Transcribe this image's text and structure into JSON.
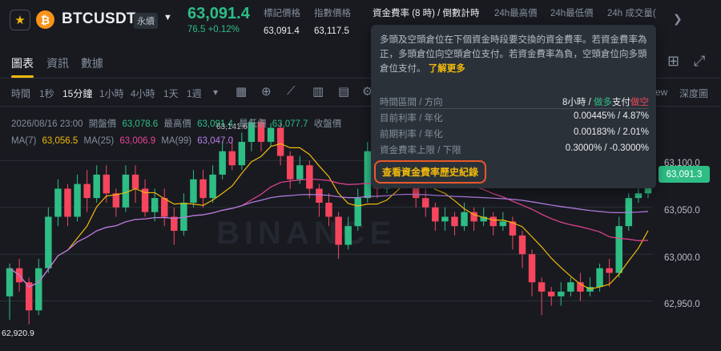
{
  "header": {
    "symbol": "BTCUSDT",
    "contract_type": "永續",
    "coin_glyph": "₿",
    "last_price": "63,091.4",
    "change": "76.5 +0.12%",
    "stats": [
      {
        "label": "標記價格",
        "value": "63,091.4"
      },
      {
        "label": "指數價格",
        "value": "63,117.5"
      },
      {
        "label": "資金費率 (8 時) / 倒數計時",
        "value": ""
      },
      {
        "label": "24h最高價",
        "value": ""
      },
      {
        "label": "24h最低價",
        "value": ""
      },
      {
        "label": "24h 成交量(",
        "value": ""
      }
    ]
  },
  "tabs": [
    "圖表",
    "資訊",
    "數據"
  ],
  "timeframes": [
    "時間",
    "1秒",
    "15分鐘",
    "1小時",
    "4小時",
    "1天",
    "1週"
  ],
  "active_timeframe": "15分鐘",
  "view_tabs": [
    "ew",
    "深度圖"
  ],
  "legend": {
    "date": "2026/08/16 23:00",
    "open_label": "開盤價",
    "open": "63,078.6",
    "high_label": "最高價",
    "high": "63,091.4",
    "low_label": "最低價",
    "low": "63,077.7",
    "close_label": "收盤價",
    "ma7_label": "MA(7)",
    "ma7": "63,056.5",
    "ma25_label": "MA(25)",
    "ma25": "63,006.9",
    "ma99_label": "MA(99)",
    "ma99": "63,047.0"
  },
  "price_axis": [
    "63,100.0",
    "63,050.0",
    "63,000.0",
    "62,950.0"
  ],
  "current_price_tag": "63,091.3",
  "high_marker": "63,141.6",
  "low_marker": "62,920.9",
  "watermark": "BINANCE",
  "tooltip": {
    "description": "多頭及空頭倉位在下個資金時段要交換的資金費率。若資金費率為正，多頭倉位向空頭倉位支付。若資金費率為負，空頭倉位向多頭倉位支付。",
    "learn_more": "了解更多",
    "rows": [
      {
        "label": "時間區間 / 方向",
        "value_prefix": "8小時 / ",
        "value_long": "做多",
        "value_mid": "支付",
        "value_short": "做空"
      },
      {
        "label": "目前利率 / 年化",
        "value": "0.00445% / 4.87%"
      },
      {
        "label": "前期利率 / 年化",
        "value": "0.00183% / 2.01%"
      },
      {
        "label": "資金費率上限 / 下限",
        "value": "0.3000% / -0.3000%"
      }
    ],
    "history_button": "查看資金費率歷史紀錄"
  },
  "colors": {
    "up": "#2ebd85",
    "down": "#f6465d",
    "ma7": "#f0b90b",
    "ma25": "#e84393",
    "ma99": "#b57fe6",
    "accent": "#f0b90b"
  },
  "chart_data": {
    "type": "candlestick",
    "ylim": [
      62900,
      63150
    ],
    "ohlc": [
      [
        62955,
        62985,
        62930,
        62990
      ],
      [
        62985,
        62970,
        62960,
        62995
      ],
      [
        62970,
        62940,
        62925,
        62975
      ],
      [
        62940,
        62985,
        62935,
        62995
      ],
      [
        62985,
        63040,
        62980,
        63050
      ],
      [
        63040,
        63070,
        63030,
        63080
      ],
      [
        63070,
        63040,
        63030,
        63075
      ],
      [
        63040,
        63075,
        63035,
        63085
      ],
      [
        63075,
        63060,
        63045,
        63090
      ],
      [
        63060,
        63085,
        63055,
        63095
      ],
      [
        63085,
        63065,
        63055,
        63095
      ],
      [
        63065,
        63050,
        63040,
        63070
      ],
      [
        63050,
        63085,
        63045,
        63095
      ],
      [
        63085,
        63070,
        63055,
        63095
      ],
      [
        63070,
        63045,
        63040,
        63080
      ],
      [
        63045,
        63060,
        63035,
        63070
      ],
      [
        63060,
        63040,
        63030,
        63070
      ],
      [
        63040,
        63025,
        63010,
        63050
      ],
      [
        63025,
        63055,
        63020,
        63065
      ],
      [
        63055,
        63080,
        63050,
        63090
      ],
      [
        63080,
        63060,
        63050,
        63090
      ],
      [
        63060,
        63085,
        63055,
        63095
      ],
      [
        63085,
        63110,
        63080,
        63120
      ],
      [
        63110,
        63095,
        63090,
        63125
      ],
      [
        63095,
        63120,
        63090,
        63130
      ],
      [
        63120,
        63141,
        63110,
        63145
      ],
      [
        63141,
        63120,
        63110,
        63145
      ],
      [
        63120,
        63135,
        63115,
        63140
      ],
      [
        63135,
        63105,
        63095,
        63140
      ],
      [
        63105,
        63080,
        63070,
        63110
      ],
      [
        63080,
        63095,
        63075,
        63105
      ],
      [
        63095,
        63070,
        63060,
        63100
      ],
      [
        63070,
        63055,
        63040,
        63075
      ],
      [
        63055,
        63040,
        63030,
        63065
      ],
      [
        63040,
        63010,
        62995,
        63045
      ],
      [
        63010,
        63030,
        63005,
        63040
      ],
      [
        63030,
        63060,
        63025,
        63070
      ],
      [
        63060,
        63110,
        63055,
        63120
      ],
      [
        63110,
        63070,
        63060,
        63115
      ],
      [
        63070,
        63085,
        63065,
        63095
      ],
      [
        63085,
        63105,
        63080,
        63110
      ],
      [
        63105,
        63080,
        63070,
        63110
      ],
      [
        63080,
        63060,
        63050,
        63085
      ],
      [
        63060,
        63050,
        63040,
        63070
      ],
      [
        63050,
        63035,
        63025,
        63055
      ],
      [
        63035,
        63040,
        63025,
        63050
      ],
      [
        63040,
        63030,
        63020,
        63045
      ],
      [
        63030,
        63045,
        63025,
        63055
      ],
      [
        63045,
        63035,
        63025,
        63050
      ],
      [
        63035,
        63040,
        63030,
        63050
      ],
      [
        63040,
        63030,
        63020,
        63045
      ],
      [
        63030,
        63035,
        63025,
        63045
      ],
      [
        63035,
        63020,
        63005,
        63040
      ],
      [
        63020,
        63000,
        62985,
        63025
      ],
      [
        63000,
        62970,
        62955,
        63005
      ],
      [
        62970,
        62960,
        62935,
        62975
      ],
      [
        62960,
        62955,
        62945,
        62965
      ],
      [
        62955,
        62960,
        62945,
        62970
      ],
      [
        62960,
        62970,
        62955,
        62975
      ],
      [
        62970,
        62960,
        62950,
        62980
      ],
      [
        62960,
        62965,
        62955,
        62975
      ],
      [
        62965,
        62985,
        62960,
        62990
      ],
      [
        62985,
        62980,
        62965,
        62995
      ],
      [
        62980,
        63030,
        62975,
        63040
      ],
      [
        63030,
        63060,
        63025,
        63065
      ],
      [
        63060,
        63065,
        63055,
        63070
      ],
      [
        63065,
        63091,
        63060,
        63095
      ]
    ]
  }
}
